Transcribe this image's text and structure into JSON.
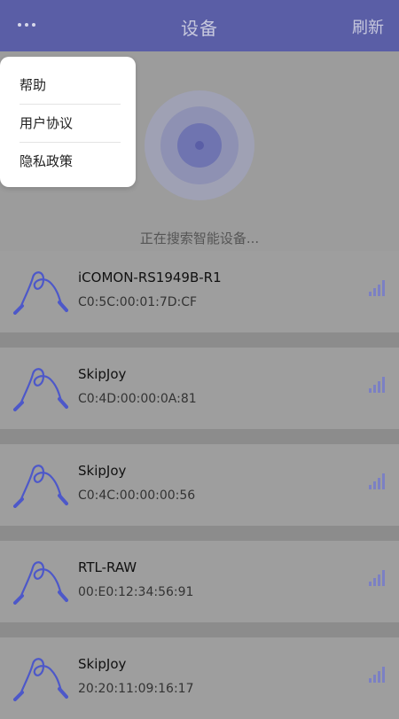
{
  "header": {
    "title": "设备",
    "refresh_label": "刷新"
  },
  "menu": {
    "items": [
      "帮助",
      "用户协议",
      "隐私政策"
    ]
  },
  "status": {
    "searching_text": "正在搜索智能设备..."
  },
  "devices": [
    {
      "name": "iCOMON-RS1949B-R1",
      "mac": "C0:5C:00:01:7D:CF"
    },
    {
      "name": "SkipJoy",
      "mac": "C0:4D:00:00:0A:81"
    },
    {
      "name": "SkipJoy",
      "mac": "C0:4C:00:00:00:56"
    },
    {
      "name": "RTL-RAW",
      "mac": "00:E0:12:34:56:91"
    },
    {
      "name": "SkipJoy",
      "mac": "20:20:11:09:16:17"
    }
  ],
  "colors": {
    "header_bg": "#5a5ea6",
    "accent": "#4d58c9"
  },
  "icons": {
    "menu": "more-dots-icon",
    "device": "jump-rope-icon",
    "signal": "signal-strength-icon",
    "radar": "radar-scan-icon"
  }
}
